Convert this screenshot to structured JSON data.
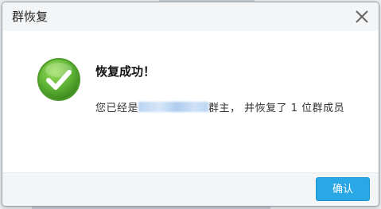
{
  "dialog": {
    "title": "群恢复",
    "heading": "恢复成功！",
    "message_prefix": "您已经是",
    "message_suffix": "群主， 并恢复了 1 位群成员",
    "confirm_label": "确认",
    "close_icon": "close-icon",
    "status_icon": "check-circle-icon"
  },
  "colors": {
    "accent": "#2aa8e6",
    "success_green": "#5fb436"
  }
}
